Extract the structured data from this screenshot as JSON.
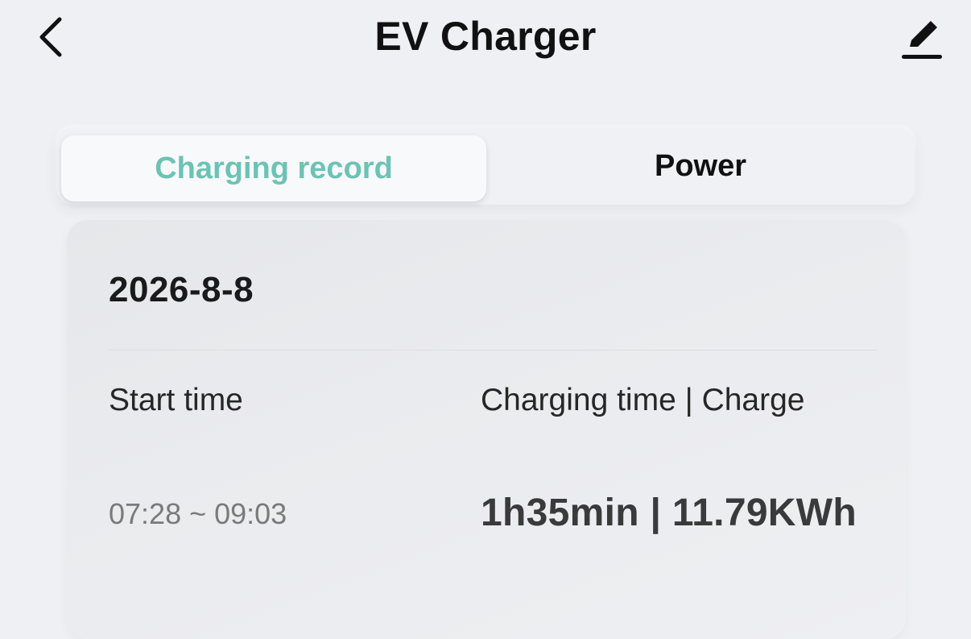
{
  "header": {
    "title": "EV Charger",
    "back_icon": "chevron-left-icon",
    "edit_icon": "pencil-icon"
  },
  "tabs": [
    {
      "label": "Charging record",
      "active": true
    },
    {
      "label": "Power",
      "active": false
    }
  ],
  "record": {
    "date": "2026-8-8",
    "start_time_label": "Start time",
    "charge_label": "Charging time | Charge",
    "time_range": "07:28 ~ 09:03",
    "charge_value": "1h35min | 11.79KWh"
  },
  "colors": {
    "accent": "#6cc3b4",
    "background": "#eef0f4"
  }
}
